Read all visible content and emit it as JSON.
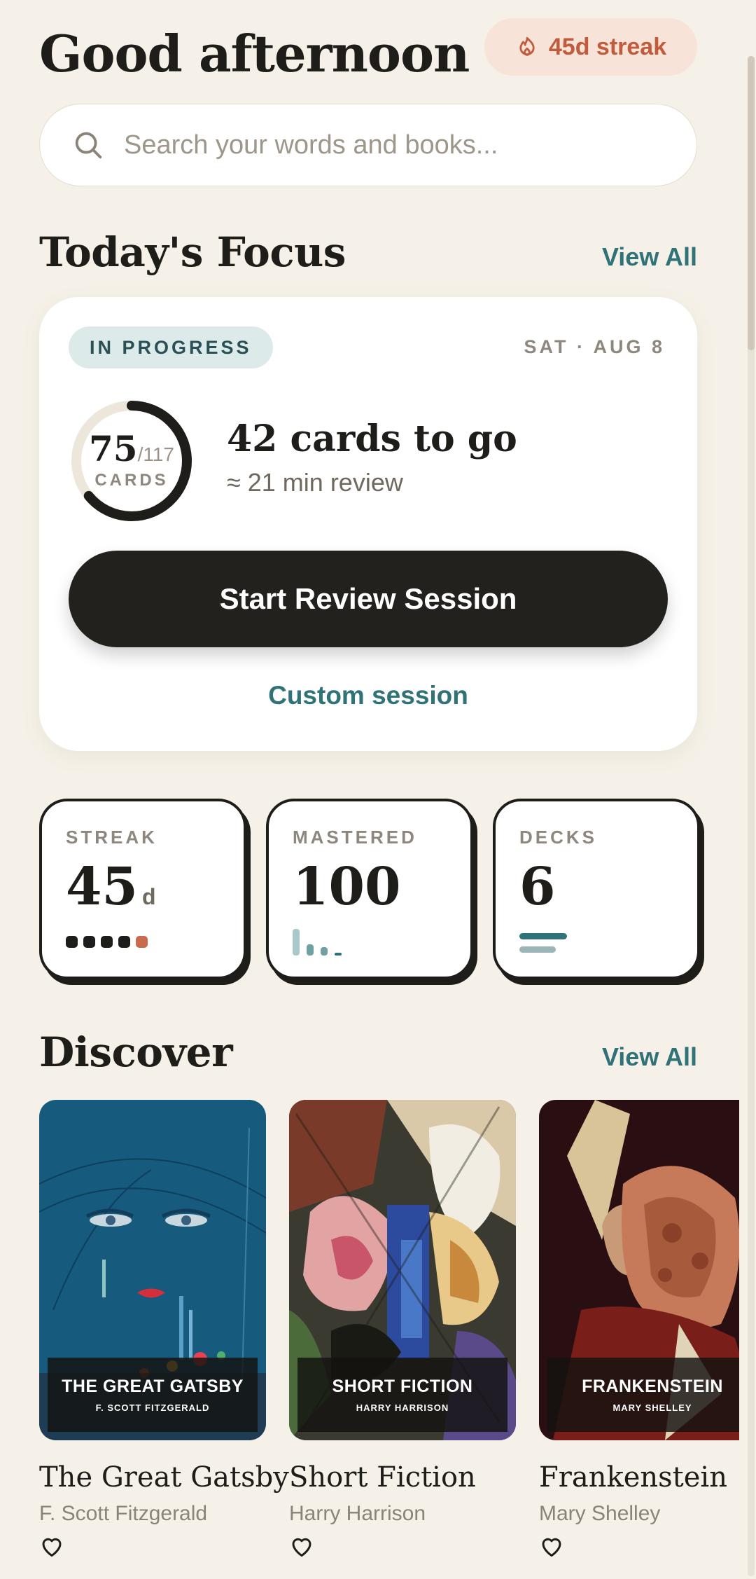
{
  "header": {
    "greeting": "Good afternoon",
    "streak_label": "45d streak"
  },
  "search": {
    "placeholder": "Search your words and books..."
  },
  "focus": {
    "section_title": "Today's Focus",
    "view_all_label": "View All",
    "status": "IN PROGRESS",
    "date": "SAT · AUG 8",
    "cards_done": "75",
    "cards_total": "/117",
    "cards_unit": "CARDS",
    "progress_fraction": 0.641,
    "cards_remaining_text": "42 cards to go",
    "review_estimate": "≈ 21 min review",
    "start_button_label": "Start Review Session",
    "custom_session_label": "Custom session"
  },
  "stats": [
    {
      "label": "STREAK",
      "value": "45",
      "unit": "d"
    },
    {
      "label": "MASTERED",
      "value": "100",
      "unit": ""
    },
    {
      "label": "DECKS",
      "value": "6",
      "unit": ""
    }
  ],
  "discover": {
    "section_title": "Discover",
    "view_all_label": "View All",
    "books": [
      {
        "title": "The Great Gatsby",
        "author": "F. Scott Fitzgerald",
        "cover_title": "THE GREAT GATSBY",
        "cover_author": "F. SCOTT FITZGERALD"
      },
      {
        "title": "Short Fiction",
        "author": "Harry Harrison",
        "cover_title": "SHORT FICTION",
        "cover_author": "HARRY HARRISON"
      },
      {
        "title": "Frankenstein",
        "author": "Mary Shelley",
        "cover_title": "FRANKENSTEIN",
        "cover_author": "MARY SHELLEY"
      }
    ]
  },
  "colors": {
    "background": "#f5f1e8",
    "accent_teal": "#2f7278",
    "streak_orange": "#c15b3d",
    "dark": "#23211e"
  },
  "icons": {
    "streak": "flame-icon",
    "search": "search-icon",
    "favorite": "heart-icon"
  }
}
